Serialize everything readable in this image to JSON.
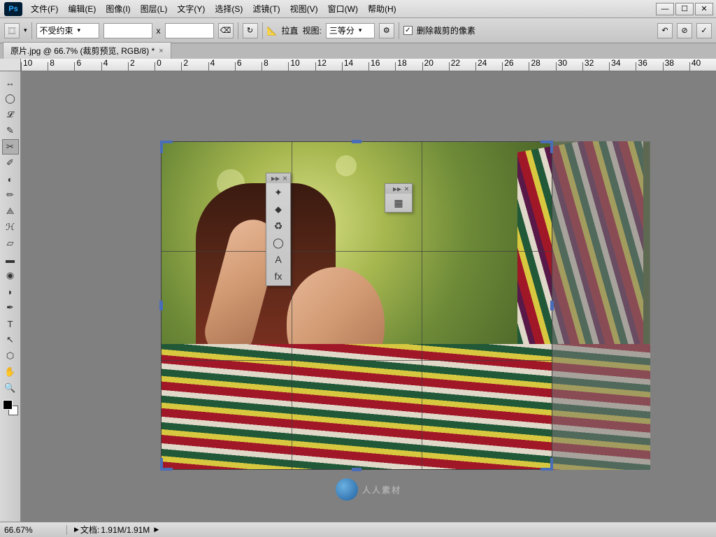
{
  "app": {
    "logo": "Ps"
  },
  "menu": {
    "file": "文件(F)",
    "edit": "编辑(E)",
    "image": "图像(I)",
    "layer": "图层(L)",
    "type": "文字(Y)",
    "select": "选择(S)",
    "filter": "滤镜(T)",
    "view": "视图(V)",
    "window": "窗口(W)",
    "help": "帮助(H)"
  },
  "options": {
    "constraint": "不受约束",
    "swap_label": "x",
    "straighten": "拉直",
    "view_label": "视图:",
    "overlay": "三等分",
    "delete_pixels": "删除裁剪的像素"
  },
  "tab": {
    "title": "原片.jpg @ 66.7% (裁剪预览, RGB/8) *"
  },
  "ruler": {
    "marks": [
      "10",
      "8",
      "6",
      "4",
      "2",
      "0",
      "2",
      "4",
      "6",
      "8",
      "10",
      "12",
      "14",
      "16",
      "18",
      "20",
      "22",
      "24",
      "26",
      "28",
      "30",
      "32",
      "34",
      "36",
      "38",
      "40"
    ]
  },
  "tools": {
    "move": "↔",
    "marquee": "◯",
    "lasso": "𝓛",
    "wand": "✎",
    "crop": "✂",
    "eyedrop": "✐",
    "heal": "◐",
    "brush": "✏",
    "stamp": "⟁",
    "history": "ℋ",
    "eraser": "▱",
    "gradient": "▬",
    "blur": "◉",
    "dodge": "◗",
    "pen": "✒",
    "text": "T",
    "path": "↖",
    "shape": "⬡",
    "hand": "✋",
    "zoom": "🔍"
  },
  "panel1": {
    "icons": [
      "✦",
      "⬥",
      "♻",
      "◯",
      "A",
      "fx"
    ]
  },
  "panel2": {
    "icons": [
      "▦"
    ]
  },
  "status": {
    "zoom": "66.67%",
    "doc_label": "文档:",
    "doc_size": "1.91M/1.91M"
  },
  "watermark": "人人素材"
}
